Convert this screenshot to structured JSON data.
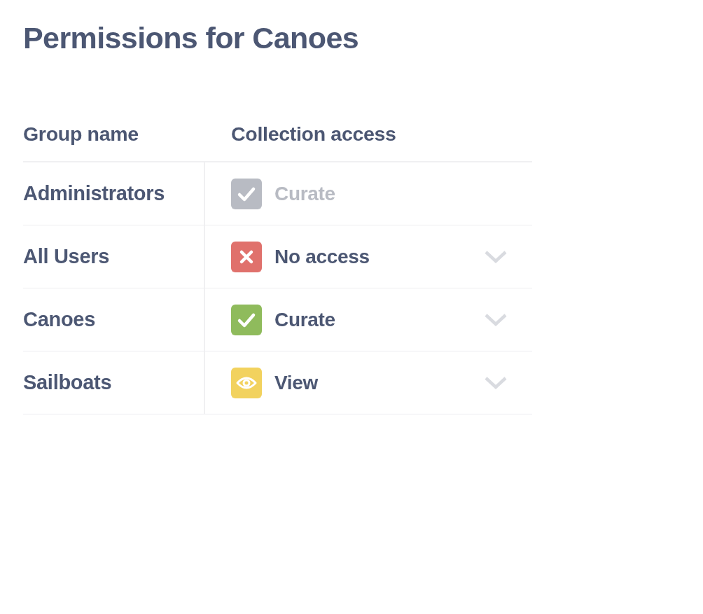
{
  "title": "Permissions for Canoes",
  "table": {
    "columns": [
      "Group name",
      "Collection access"
    ],
    "rows": [
      {
        "group": "Administrators",
        "access": {
          "kind": "curate",
          "label": "Curate",
          "disabled": true
        }
      },
      {
        "group": "All Users",
        "access": {
          "kind": "no_access",
          "label": "No access",
          "disabled": false
        }
      },
      {
        "group": "Canoes",
        "access": {
          "kind": "curate",
          "label": "Curate",
          "disabled": false
        }
      },
      {
        "group": "Sailboats",
        "access": {
          "kind": "view",
          "label": "View",
          "disabled": false
        }
      }
    ]
  }
}
